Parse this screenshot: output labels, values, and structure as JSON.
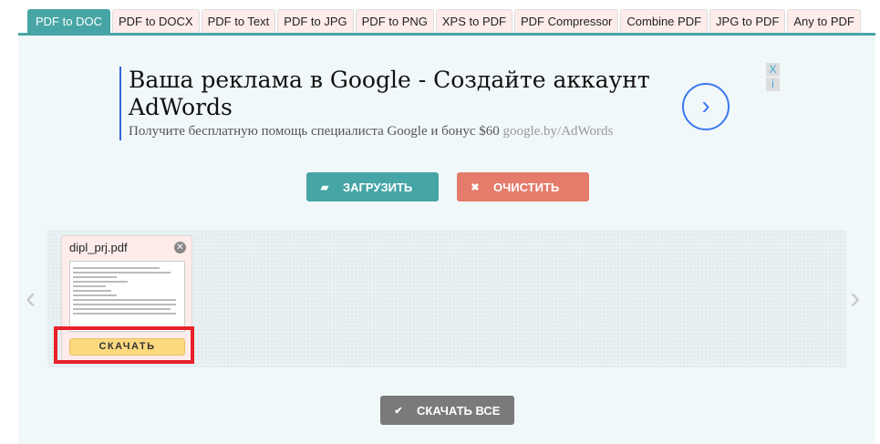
{
  "tabs": [
    "PDF to DOC",
    "PDF to DOCX",
    "PDF to Text",
    "PDF to JPG",
    "PDF to PNG",
    "XPS to PDF",
    "PDF Compressor",
    "Combine PDF",
    "JPG to PDF",
    "Any to PDF"
  ],
  "ad": {
    "title": "Ваша реклама в Google - Создайте аккаунт AdWords",
    "subtitle": "Получите бесплатную помощь специалиста Google и бонус $60",
    "url": "google.by/AdWords",
    "go": "›",
    "close": "X",
    "info": "i"
  },
  "buttons": {
    "upload": "ЗАГРУЗИТЬ",
    "clear": "ОЧИСТИТЬ",
    "download_all": "СКАЧАТЬ ВСЕ"
  },
  "file": {
    "name": "dipl_prj.pdf",
    "download": "СКАЧАТЬ"
  },
  "nav": {
    "prev": "‹",
    "next": "›"
  }
}
